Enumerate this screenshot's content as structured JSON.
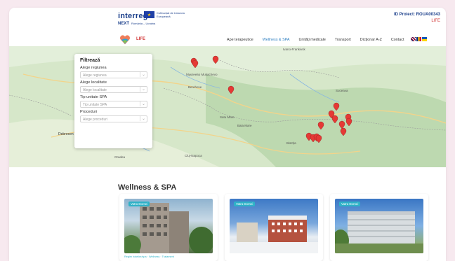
{
  "header": {
    "interreg_logo_text": "interreg",
    "next_text": "NEXT",
    "next_sub": "România – Ucraina",
    "eu_text": "Cofinanțat de Uniunea Europeană",
    "project_id": "ID Proiect: ROUA00343",
    "project_name": "LIFE"
  },
  "nav": {
    "logo_text": "LIFE",
    "items": [
      {
        "label": "Ape terapeutice"
      },
      {
        "label": "Wellness & SPA",
        "active": true
      },
      {
        "label": "Unități medicale"
      },
      {
        "label": "Transport"
      },
      {
        "label": "Dicționar A-Z"
      },
      {
        "label": "Contact"
      }
    ]
  },
  "map": {
    "place_labels": [
      "Ivano-Frankivsk",
      "Мукачево Mukachevo",
      "Berehove",
      "Debrecen",
      "Baia Mare",
      "Satu Mare",
      "Bistrița",
      "Suceava",
      "Cluj-Napoca",
      "Oradea"
    ],
    "marker_color": "#e53935"
  },
  "filter": {
    "title": "Filtrează",
    "region_label": "Alege regiunea",
    "region_placeholder": "Alege regiunea",
    "locality_label": "Alege localitate",
    "locality_placeholder": "Alege localitate",
    "spa_label": "Tip unitate SPA",
    "spa_placeholder": "Tip unitate SPA",
    "proc_label": "Proceduri",
    "proc_placeholder": "Alege proceduri"
  },
  "content": {
    "section_title": "Wellness & SPA",
    "cards": [
      {
        "badge": "Vatra Dornei",
        "caption": "Regim hotelier/spa · Wellness · Tratament"
      },
      {
        "badge": "Vatra Dornei",
        "caption": ""
      },
      {
        "badge": "Vatra Dornei",
        "caption": ""
      }
    ]
  }
}
